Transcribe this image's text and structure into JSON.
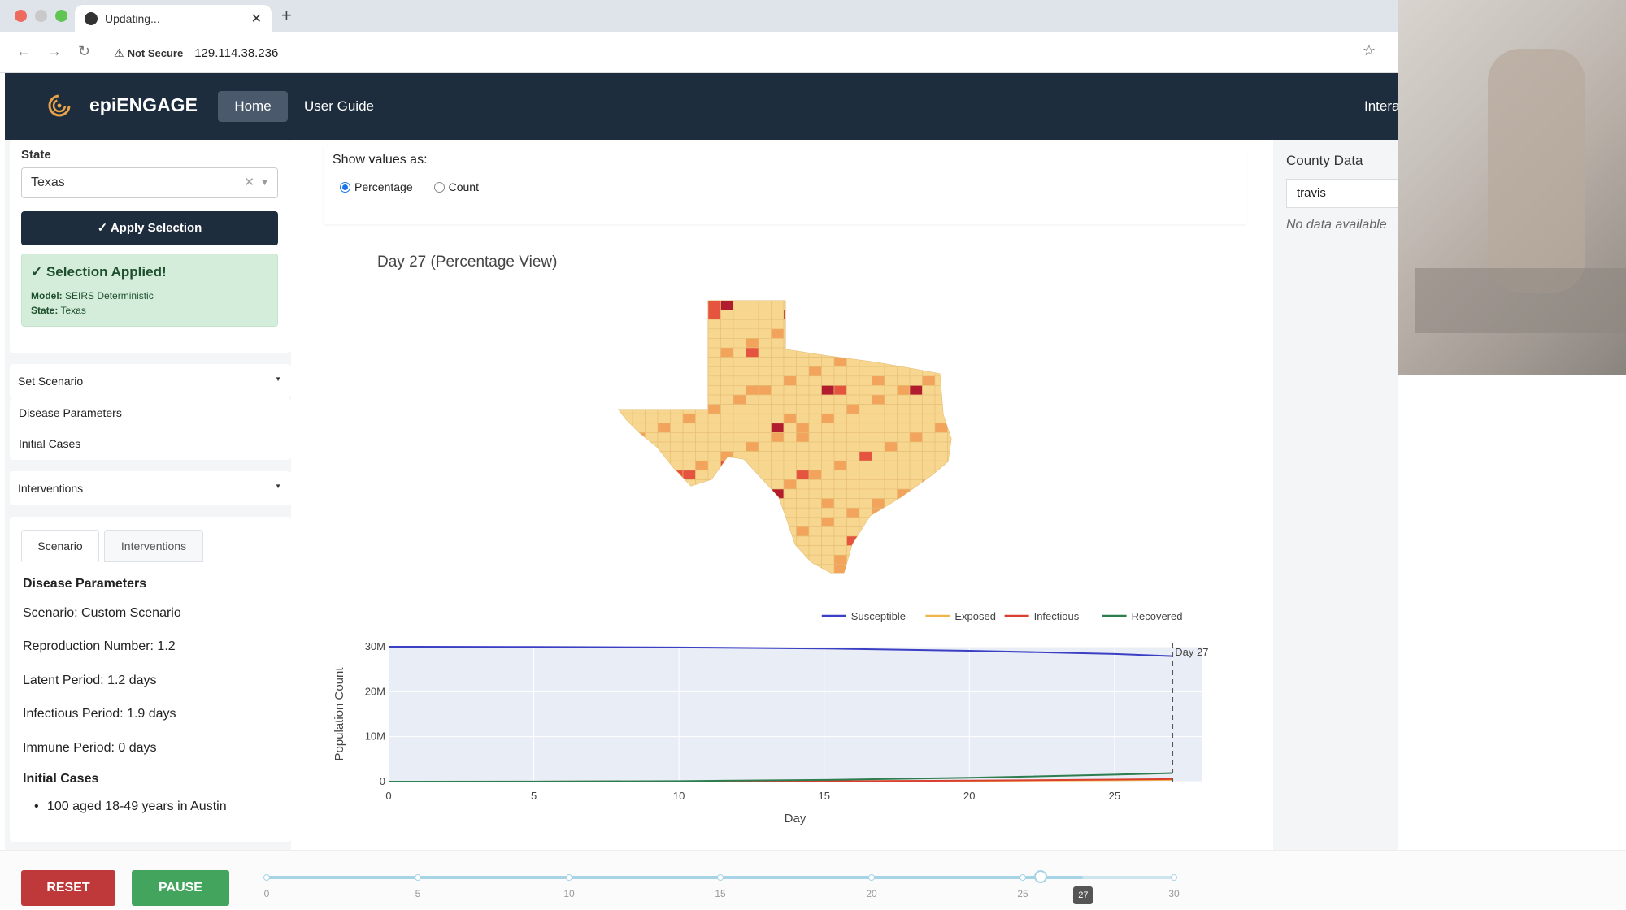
{
  "browser": {
    "tab_title": "Updating...",
    "tab_close": "✕",
    "new_tab": "+",
    "not_secure": "Not Secure",
    "url": "129.114.38.236"
  },
  "navbar": {
    "brand": "epiENGAGE",
    "home": "Home",
    "user_guide": "User Guide",
    "interactive": "Intera"
  },
  "sidebar": {
    "state_label": "State",
    "state_value": "Texas",
    "apply_button": "✓ Apply Selection",
    "success": {
      "title": "✓ Selection Applied!",
      "model_label": "Model:",
      "model_value": "SEIRS Deterministic",
      "state_label": "State:",
      "state_value": "Texas"
    },
    "set_scenario": "Set Scenario",
    "disease_parameters": "Disease Parameters",
    "initial_cases": "Initial Cases",
    "interventions": "Interventions",
    "tabs": [
      "Scenario",
      "Interventions"
    ],
    "summary": {
      "disease_heading": "Disease Parameters",
      "scenario": "Scenario: Custom Scenario",
      "r0": "Reproduction Number: 1.2",
      "latent": "Latent Period: 1.2 days",
      "infectious": "Infectious Period: 1.9 days",
      "immune": "Immune Period: 0 days",
      "initial_heading": "Initial Cases",
      "initial_item": "100 aged 18-49 years in Austin"
    }
  },
  "controls": {
    "show_values_label": "Show values as:",
    "options": [
      "Percentage",
      "Count"
    ],
    "selected": "Percentage"
  },
  "map": {
    "title": "Day 27 (Percentage View)",
    "colors": {
      "low": "#f7d68f",
      "mid": "#f2a35c",
      "high": "#e4543f",
      "max": "#b11d2e"
    }
  },
  "chart_data": {
    "type": "line",
    "title": "",
    "xlabel": "Day",
    "ylabel": "Population Count",
    "xlim": [
      0,
      28
    ],
    "ylim": [
      0,
      30000000
    ],
    "x_ticks": [
      "0",
      "5",
      "10",
      "15",
      "20",
      "25"
    ],
    "y_ticks": [
      "0",
      "10M",
      "20M",
      "30M"
    ],
    "x": [
      0,
      5,
      10,
      15,
      20,
      25,
      27
    ],
    "series": [
      {
        "name": "Susceptible",
        "color": "#3a3fc4",
        "values": [
          30000000,
          29950000,
          29850000,
          29600000,
          29100000,
          28400000,
          27900000
        ]
      },
      {
        "name": "Exposed",
        "color": "#f0b44c",
        "values": [
          0,
          5000,
          20000,
          60000,
          150000,
          300000,
          380000
        ]
      },
      {
        "name": "Infectious",
        "color": "#d9402f",
        "values": [
          0,
          8000,
          30000,
          90000,
          220000,
          450000,
          560000
        ]
      },
      {
        "name": "Recovered",
        "color": "#2e7d4f",
        "values": [
          0,
          20000,
          120000,
          380000,
          850000,
          1550000,
          1900000
        ]
      }
    ],
    "marker": {
      "x": 27,
      "label": "Day 27"
    },
    "legend": "top-right"
  },
  "right_panel": {
    "county_label": "County Data",
    "county_value": "travis",
    "no_data": "No data available"
  },
  "bottom": {
    "reset": "RESET",
    "pause": "PAUSE",
    "slider": {
      "min": 0,
      "max": 30,
      "value": 27,
      "ticks": [
        "0",
        "5",
        "10",
        "15",
        "20",
        "25",
        "30"
      ],
      "value_label": "27"
    }
  }
}
